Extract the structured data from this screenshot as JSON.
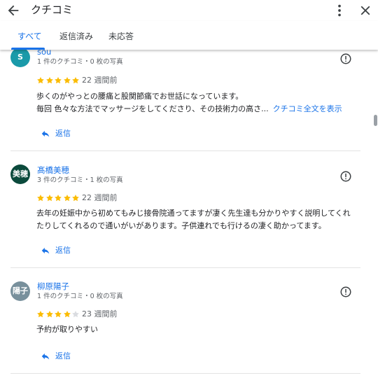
{
  "header": {
    "title": "クチコミ"
  },
  "tabs": [
    {
      "label": "すべて"
    },
    {
      "label": "返信済み"
    },
    {
      "label": "未応答"
    }
  ],
  "reviews": [
    {
      "avatar_letter": "S",
      "avatar_color": "#1a9aa9",
      "name": "sou",
      "meta": "1 件のクチコミ・0 枚の写真",
      "rating": 5,
      "when": "22 週間前",
      "line1": "歩くのがやっとの腰痛と股関節痛でお世話になっています。",
      "line2": "毎回 色々な方法でマッサージをしてくださり、その技術力の高さ...",
      "more_label": "クチコミ全文を表示",
      "reply_label": "返信"
    },
    {
      "avatar_letter": "美穂",
      "avatar_color": "#0b4a3c",
      "name": "髙橋美穂",
      "meta": "3 件のクチコミ・1 枚の写真",
      "rating": 5,
      "when": "22 週間前",
      "line1": "去年の妊娠中から初めてもみじ接骨院通ってますが凄く先生達も分かりやすく説明してくれ",
      "line2": "たりしてくれるので通いがいがあります。子供連れでも行けるの凄く助かってます。",
      "reply_label": "返信"
    },
    {
      "avatar_letter": "陽子",
      "avatar_color": "#78909c",
      "name": "柳原陽子",
      "meta": "1 件のクチコミ・0 枚の写真",
      "rating": 4,
      "when": "23 週間前",
      "line1": "予約が取りやすい",
      "reply_label": "返信"
    }
  ],
  "colors": {
    "accent": "#1a73e8",
    "star_on": "#fbbc04",
    "star_off": "#dadce0"
  }
}
